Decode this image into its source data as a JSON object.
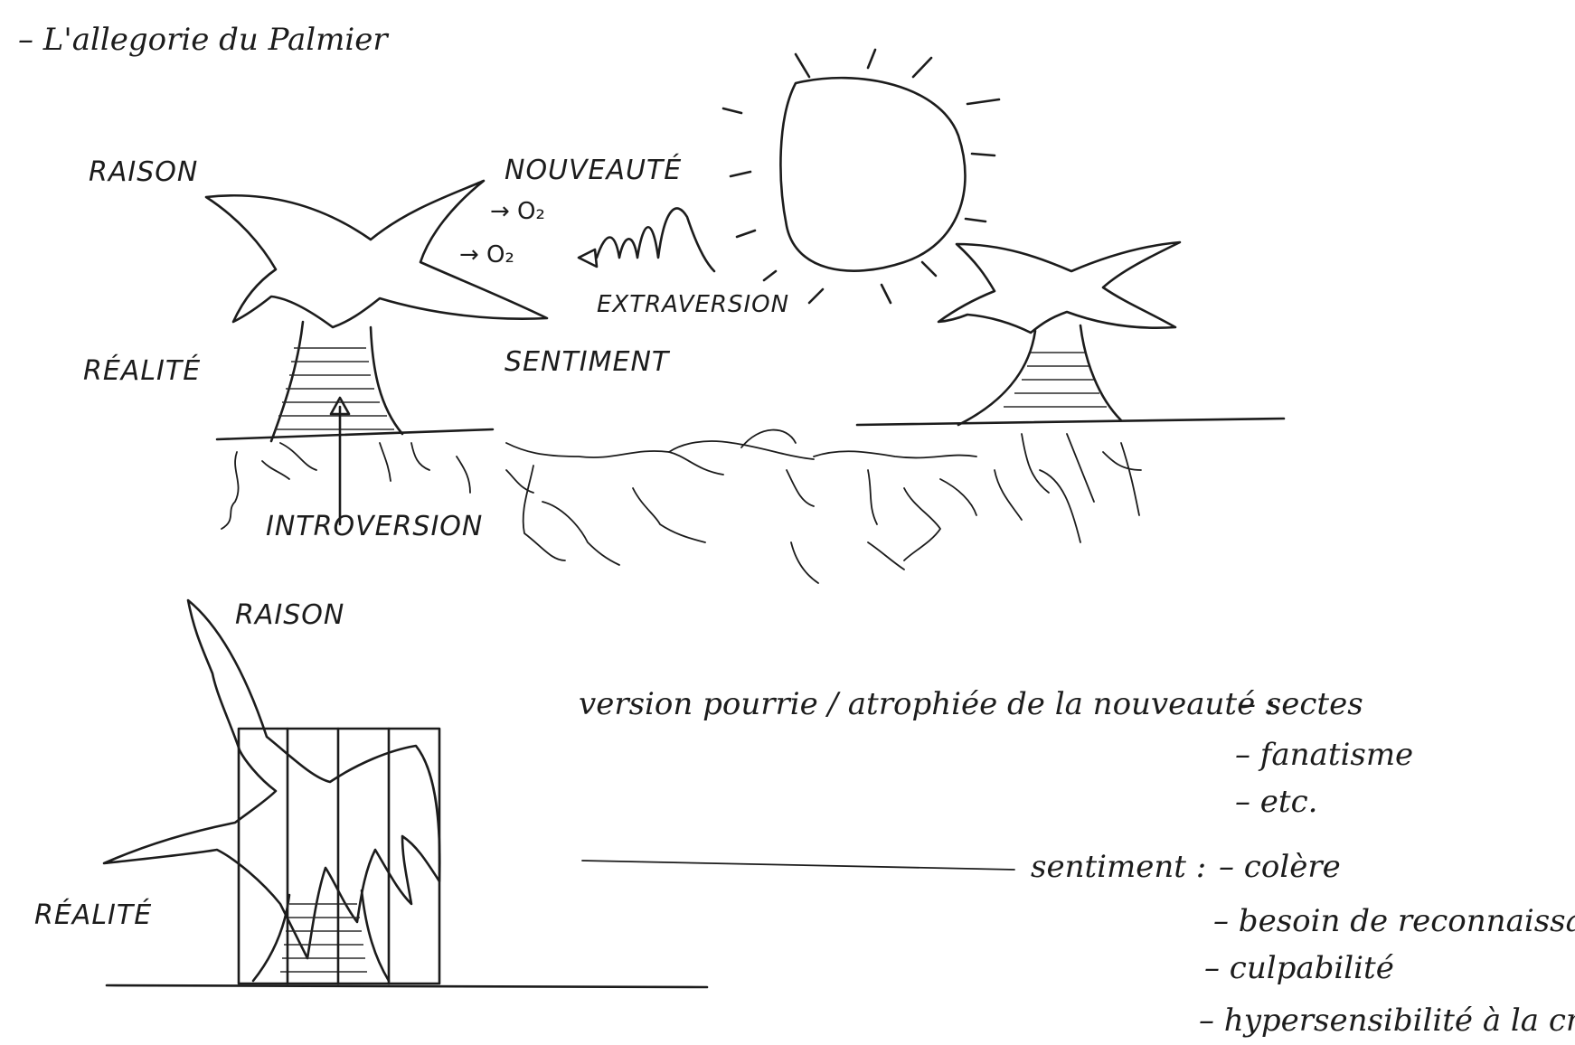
{
  "title": "– L'allegorie du Palmier",
  "labels": {
    "raison_top": "RAISON",
    "realite_top": "RÉALITÉ",
    "nouveaute": "NOUVEAUTÉ",
    "o2_a": "→ O₂",
    "o2_b": "→ O₂",
    "extraversion": "EXTRAVERSION",
    "sentiment": "SENTIMENT",
    "introversion": "INTROVERSION",
    "raison_bottom": "RAISON",
    "realite_bottom": "RÉALITÉ"
  },
  "notes": {
    "nouveaute_line": "version pourrie / atrophiée de la nouveauté :",
    "nouveaute_items": [
      "– sectes",
      "– fanatisme",
      "– etc."
    ],
    "sentiment_line": "sentiment :",
    "sentiment_items": [
      "– colère",
      "– besoin de reconnaissance",
      "– culpabilité",
      "– hypersensibilité à la critique"
    ]
  }
}
